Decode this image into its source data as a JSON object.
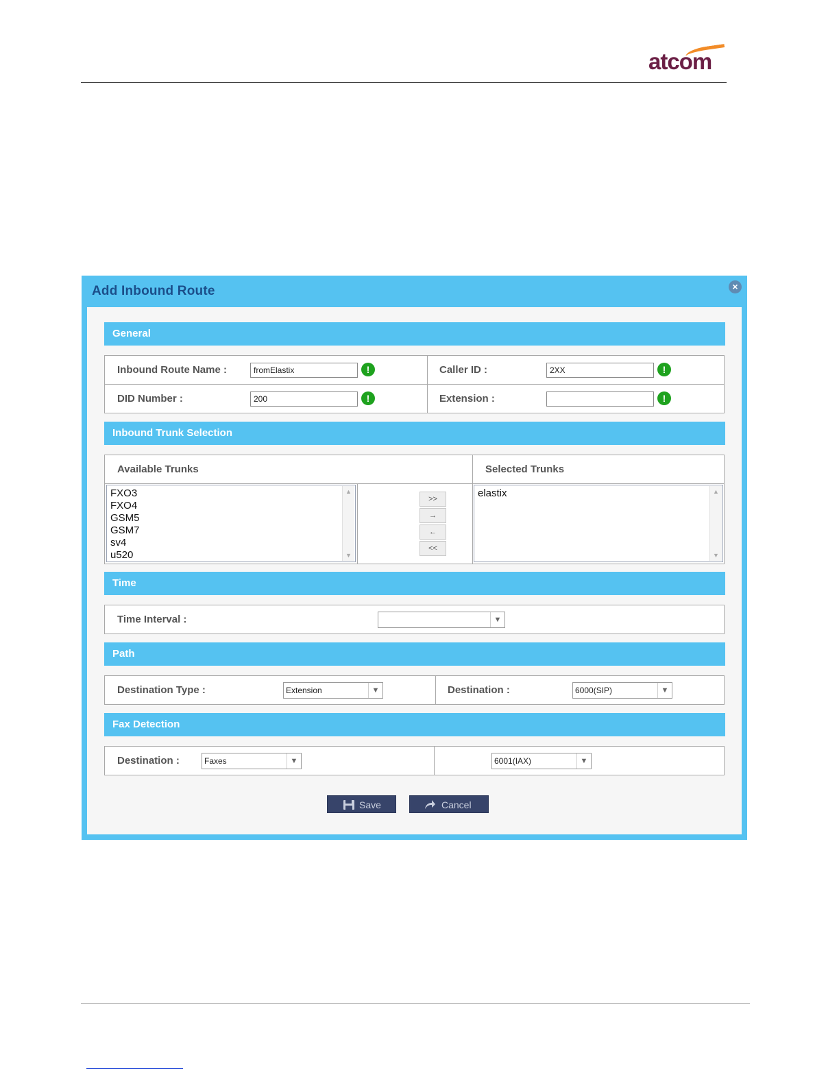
{
  "brand": {
    "logo_text": "atcom"
  },
  "dialog": {
    "title": "Add Inbound Route",
    "close_icon": "close-circle-icon"
  },
  "general": {
    "header": "General",
    "route_name_label": "Inbound Route Name :",
    "route_name_value": "fromElastix",
    "caller_id_label": "Caller ID :",
    "caller_id_value": "2XX",
    "did_label": "DID Number :",
    "did_value": "200",
    "extension_label": "Extension :",
    "extension_value": "",
    "warn_glyph": "!"
  },
  "trunks": {
    "header": "Inbound Trunk Selection",
    "available_label": "Available Trunks",
    "selected_label": "Selected Trunks",
    "available": [
      "FXO3",
      "FXO4",
      "GSM5",
      "GSM7",
      "sv4",
      "u520"
    ],
    "selected": [
      "elastix"
    ],
    "buttons": {
      "add_all": ">>",
      "add": "→",
      "remove": "←",
      "remove_all": "<<"
    }
  },
  "time": {
    "header": "Time",
    "interval_label": "Time Interval :",
    "interval_value": ""
  },
  "path": {
    "header": "Path",
    "dest_type_label": "Destination Type :",
    "dest_type_value": "Extension",
    "destination_label": "Destination :",
    "destination_value": "6000(SIP)"
  },
  "fax": {
    "header": "Fax Detection",
    "destination_label": "Destination :",
    "destination_value": "Faxes",
    "target_value": "6001(IAX)"
  },
  "actions": {
    "save_label": "Save",
    "cancel_label": "Cancel"
  },
  "colors": {
    "accent": "#55c2f1",
    "title": "#1b4e8a",
    "button": "#37446a",
    "warn": "#1ea21e",
    "brand": "#6b1f45",
    "brand_swoosh": "#f28c28"
  }
}
